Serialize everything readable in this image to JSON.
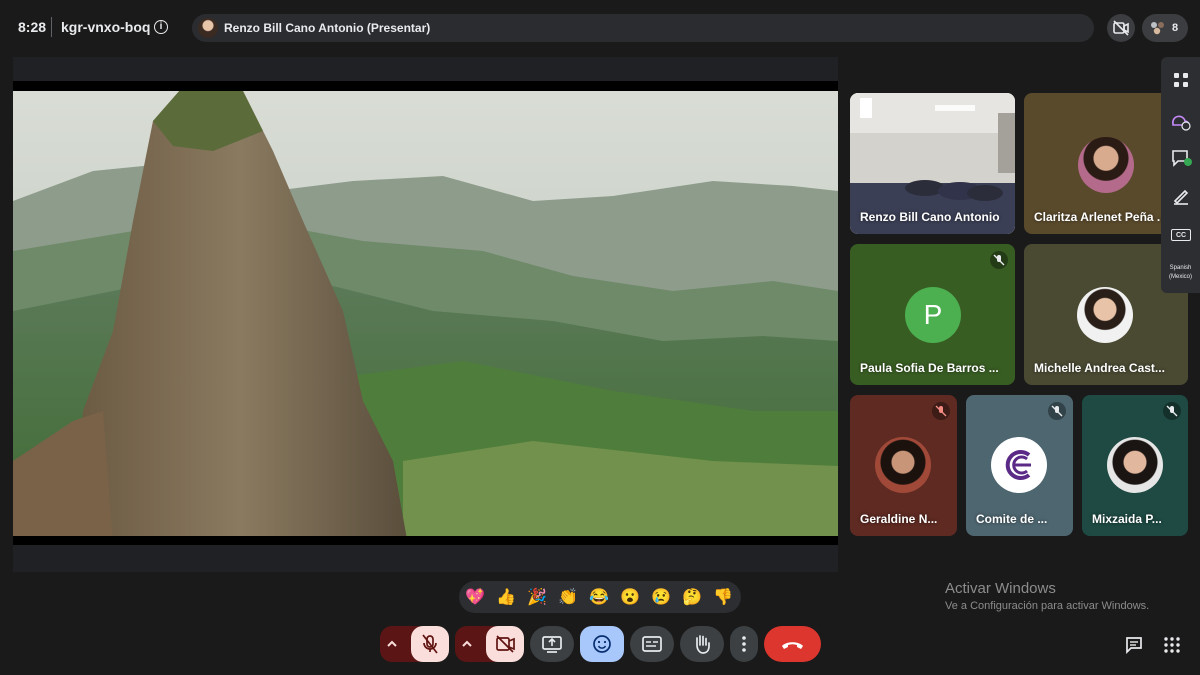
{
  "topbar": {
    "time": "8:28",
    "meeting_code": "kgr-vnxo-boq",
    "presenter_label": "Renzo Bill Cano Antonio (Presentar)",
    "people_count": "8"
  },
  "participants": [
    {
      "name": "Renzo Bill Cano Antonio",
      "muted": false,
      "kind": "video"
    },
    {
      "name": "Claritza Arlenet Peña ...",
      "muted": false,
      "kind": "photo"
    },
    {
      "name": "Paula Sofia De Barros ...",
      "muted": true,
      "kind": "letter",
      "letter": "P",
      "color": "#4caf50"
    },
    {
      "name": "Michelle Andrea Cast...",
      "muted": false,
      "kind": "photo"
    },
    {
      "name": "Geraldine N...",
      "muted": true,
      "kind": "photo"
    },
    {
      "name": "Comite de ...",
      "muted": true,
      "kind": "logo"
    },
    {
      "name": "Mixzaida P...",
      "muted": true,
      "kind": "photo"
    }
  ],
  "sidepanel": {
    "captions_label": "CC",
    "language": "Spanish (Mexico)"
  },
  "reactions": [
    "💖",
    "👍",
    "🎉",
    "👏",
    "😂",
    "😮",
    "😢",
    "🤔",
    "👎"
  ],
  "watermark": {
    "title": "Activar Windows",
    "subtitle": "Ve a Configuración para activar Windows."
  },
  "controls": {
    "mic": "off",
    "camera": "off",
    "present": "present-screen-icon",
    "emoji": "emoji-icon",
    "captions": "captions-icon",
    "raise_hand": "raise-hand-icon",
    "more": "more-options-icon",
    "leave": "end-call-icon"
  },
  "colors": {
    "end_call": "#dc362e",
    "off_state": "#f9dedc",
    "off_caret": "#5c1515",
    "emoji_active": "#a8c7fa",
    "background": "#1a1a1a"
  }
}
